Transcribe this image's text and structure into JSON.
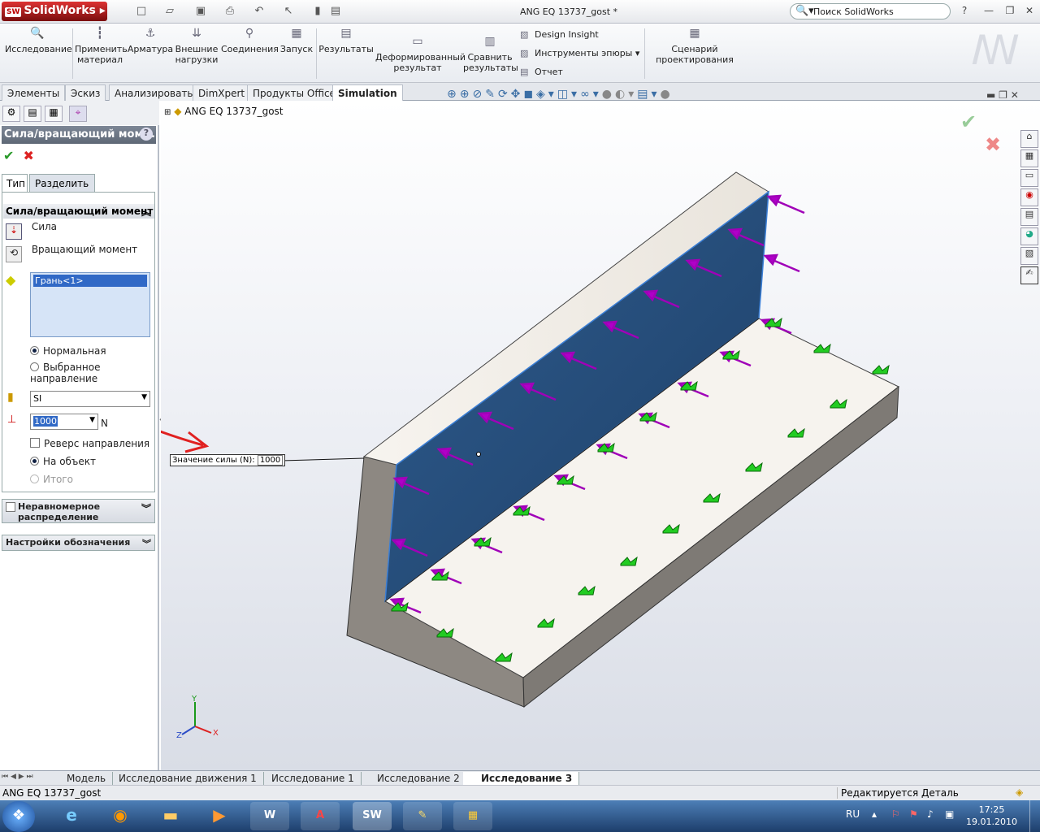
{
  "app": {
    "logo": "SolidWorks",
    "document_title": "ANG EQ 13737_gost *",
    "search_placeholder": "Поиск SolidWorks"
  },
  "ribbon": {
    "buttons": [
      {
        "label": "Исследование",
        "icon": "study-icon"
      },
      {
        "label": "Применить материал",
        "icon": "material-icon"
      },
      {
        "label": "Арматура",
        "icon": "fixture-icon"
      },
      {
        "label": "Внешние нагрузки",
        "icon": "loads-icon"
      },
      {
        "label": "Соединения",
        "icon": "connections-icon"
      },
      {
        "label": "Запуск",
        "icon": "run-icon"
      },
      {
        "label": "Результаты",
        "icon": "results-icon"
      },
      {
        "label": "Деформированный результат",
        "icon": "deformed-icon"
      },
      {
        "label": "Сравнить результаты",
        "icon": "compare-icon"
      },
      {
        "label": "Сценарий проектирования",
        "icon": "scenario-icon"
      }
    ],
    "small": [
      "Design Insight",
      "Инструменты эпюры",
      "Отчет"
    ]
  },
  "tabs": [
    "Элементы",
    "Эскиз",
    "Анализировать",
    "DimXpert",
    "Продукты Office",
    "Simulation"
  ],
  "panel": {
    "title": "Сила/вращающий мом...",
    "tab_type": "Тип",
    "tab_split": "Разделить",
    "group_title": "Сила/вращающий момент",
    "opt_force": "Сила",
    "opt_torque": "Вращающий момент",
    "selection": "Грань<1>",
    "radio_normal": "Нормальная",
    "radio_selected_dir": "Выбранное направление",
    "units": "SI",
    "force_value": "1000",
    "force_unit": "N",
    "reverse": "Реверс направления",
    "per_item": "На объект",
    "total": "Итого",
    "nonuniform": "Неравномерное распределение",
    "symbol_settings": "Настройки обозначения"
  },
  "viewport": {
    "tree_root": "ANG EQ 13737_gost",
    "callout_label": "Значение силы (N):",
    "callout_value": "1000"
  },
  "bottom_tabs": [
    "Модель",
    "Исследование движения 1",
    "Исследование 1",
    "Исследование 2",
    "Исследование 3"
  ],
  "status": {
    "left": "ANG EQ 13737_gost",
    "right": "Редактируется Деталь"
  },
  "taskbar": {
    "lang": "RU",
    "time": "17:25",
    "date": "19.01.2010"
  }
}
